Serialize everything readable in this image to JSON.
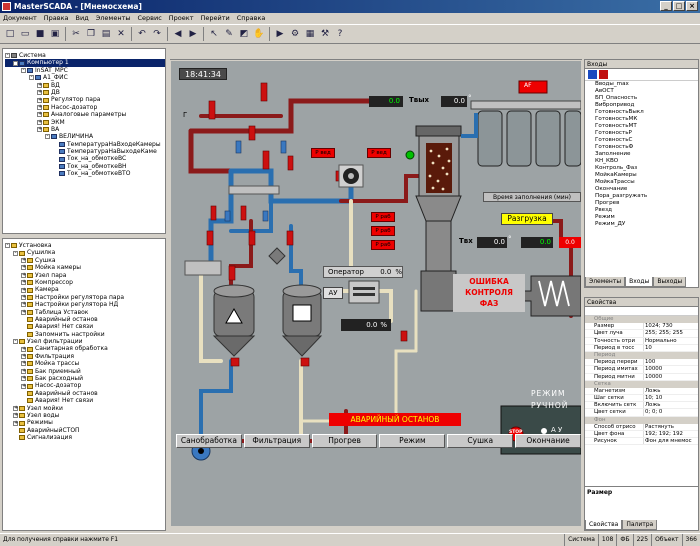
{
  "window": {
    "title": "MasterSCADA - [Мнемосхема]"
  },
  "menu": [
    "Документ",
    "Правка",
    "Вид",
    "Элементы",
    "Сервис",
    "Проект",
    "Перейти",
    "Справка"
  ],
  "toolbar_icons": [
    "new-icon",
    "open-icon",
    "save-icon",
    "save-all-icon",
    "cut-icon",
    "copy-icon",
    "paste-icon",
    "delete-icon",
    "undo-icon",
    "redo-icon",
    "back-icon",
    "forward-icon",
    "pointer-icon",
    "pen-icon",
    "fill-icon",
    "hand-icon",
    "run-icon",
    "debug-icon",
    "grid-icon",
    "tools-icon",
    "help-icon"
  ],
  "tree_system": [
    {
      "label": "Система",
      "level": 0,
      "icon": "m",
      "exp": "-"
    },
    {
      "label": "Компьютер 1",
      "level": 1,
      "icon": "b",
      "exp": "-",
      "selected": true
    },
    {
      "label": "InSAT_MPC",
      "level": 2,
      "icon": "b",
      "exp": "-"
    },
    {
      "label": "A1_ФИС",
      "level": 3,
      "icon": "b",
      "exp": "-"
    },
    {
      "label": "ВД",
      "level": 4,
      "icon": "",
      "exp": "+"
    },
    {
      "label": "ДВ",
      "level": 4,
      "icon": "",
      "exp": "+"
    },
    {
      "label": "Регулятор пара",
      "level": 4,
      "icon": "",
      "exp": "+"
    },
    {
      "label": "Насос-дозатор",
      "level": 4,
      "icon": "",
      "exp": "+"
    },
    {
      "label": "Аналоговые параметры",
      "level": 4,
      "icon": "",
      "exp": "+"
    },
    {
      "label": "ЭКМ",
      "level": 4,
      "icon": "",
      "exp": "+"
    },
    {
      "label": "ВА",
      "level": 4,
      "icon": "",
      "exp": "+"
    },
    {
      "label": "ВЕЛИЧИНА",
      "level": 5,
      "icon": "b",
      "exp": "-"
    },
    {
      "label": "ТемператураНаВходеКамеры",
      "level": 6,
      "icon": "b",
      "exp": ""
    },
    {
      "label": "ТемператураНаВыходеКаме",
      "level": 6,
      "icon": "b",
      "exp": ""
    },
    {
      "label": "Ток_на_обмоткеВС",
      "level": 6,
      "icon": "b",
      "exp": ""
    },
    {
      "label": "Ток_на_обмоткеВН",
      "level": 6,
      "icon": "b",
      "exp": ""
    },
    {
      "label": "Ток_на_обмоткеВТО",
      "level": 6,
      "icon": "b",
      "exp": ""
    }
  ],
  "tree_install": [
    {
      "label": "Установка",
      "level": 0,
      "exp": "-"
    },
    {
      "label": "Сушилка",
      "level": 1,
      "exp": "-"
    },
    {
      "label": "Сушка",
      "level": 2,
      "exp": "+"
    },
    {
      "label": "Мойка камеры",
      "level": 2,
      "exp": "+"
    },
    {
      "label": "Узел пара",
      "level": 2,
      "exp": "+"
    },
    {
      "label": "Компрессор",
      "level": 2,
      "exp": "+"
    },
    {
      "label": "Камера",
      "level": 2,
      "exp": "+"
    },
    {
      "label": "Настройки регулятора пара",
      "level": 2,
      "exp": "+"
    },
    {
      "label": "Настройки регулятора НД",
      "level": 2,
      "exp": "+"
    },
    {
      "label": "Таблица Уставок",
      "level": 2,
      "exp": "+"
    },
    {
      "label": "Аварийный останов",
      "level": 2,
      "exp": ""
    },
    {
      "label": "Авария! Нет связи",
      "level": 2,
      "exp": ""
    },
    {
      "label": "Запомнить настройки",
      "level": 2,
      "exp": ""
    },
    {
      "label": "Узел фильтрации",
      "level": 1,
      "exp": "-"
    },
    {
      "label": "Санитарная обработка",
      "level": 2,
      "exp": "+"
    },
    {
      "label": "Фильтрация",
      "level": 2,
      "exp": "+"
    },
    {
      "label": "Мойка трассы",
      "level": 2,
      "exp": "+"
    },
    {
      "label": "Бак приемный",
      "level": 2,
      "exp": "+"
    },
    {
      "label": "Бак расходный",
      "level": 2,
      "exp": "+"
    },
    {
      "label": "Насос-дозатор",
      "level": 2,
      "exp": "+"
    },
    {
      "label": "Аварийный останов",
      "level": 2,
      "exp": ""
    },
    {
      "label": "Авария! Нет связи",
      "level": 2,
      "exp": ""
    },
    {
      "label": "Узел мойки",
      "level": 1,
      "exp": "+"
    },
    {
      "label": "Узел воды",
      "level": 1,
      "exp": "+"
    },
    {
      "label": "Режимы",
      "level": 1,
      "exp": "+"
    },
    {
      "label": "АварийныйСТОП",
      "level": 1,
      "exp": ""
    },
    {
      "label": "Сигнализация",
      "level": 1,
      "exp": ""
    }
  ],
  "scada": {
    "time": "18:41:34",
    "g_label": "Г",
    "t_out_label": "Твых",
    "t_out_value": "0.0",
    "t_out_unit": "°",
    "t_in_label": "Твх",
    "t_in_value": "0.0",
    "t_in_unit": "°",
    "green_value": "0.0",
    "green_value2": "0.0",
    "red_value": "0.0",
    "fill_time": "Время заполнения (мин)",
    "unload": "Разгрузка",
    "operator": "Оператор",
    "operator_value": "0.0",
    "operator_unit": "%",
    "au": "АУ",
    "pct_value": "0.0",
    "pct_unit": "%",
    "error_lines": [
      "ОШИБКА",
      "КОНТРОЛЯ",
      "ФАЗ"
    ],
    "emergency": "АВАРИЙНЫЙ ОСТАНОВ",
    "mode_label1": "РЕЖИМ",
    "mode_label2": "РУЧНОЙ",
    "stop": "STOP",
    "radio_au": "А У",
    "radio_du": "Д У",
    "heater_label": "AF",
    "small_labels": [
      "Р вед",
      "Р вед",
      "Р раб",
      "Р раб",
      "Р раб"
    ],
    "nav": [
      "Санобработка",
      "Фильтрация",
      "Прогрев",
      "Режим",
      "Сушка",
      "Окончание"
    ]
  },
  "inputs_panel": {
    "title": "Входы",
    "items": [
      "Вводы_max",
      "АвОСТ",
      "БП_Опасность",
      "Вибропривод",
      "ГотовностьВыкл",
      "ГотовностьМК",
      "ГотовностьМТ",
      "ГотовностьР",
      "ГотовностьС",
      "ГотовностьФ",
      "Заполнение",
      "КН_КВО",
      "Контроль_Фаз",
      "МойкаКамеры",
      "МойкаТрассы",
      "Окончание",
      "Пора_разгружать",
      "Прогрев",
      "Рвезд",
      "Режим",
      "Режим_ДУ"
    ],
    "tabs": [
      "Элементы",
      "Входы",
      "Выходы"
    ]
  },
  "props_panel": {
    "title": "Свойства",
    "rows": [
      {
        "group": "Общие"
      },
      {
        "k": "Размер",
        "v": "1024; 730"
      },
      {
        "k": "Цвет луча",
        "v": "255; 255; 255"
      },
      {
        "k": "Точность отри",
        "v": "Нормально"
      },
      {
        "k": "Период в тосс",
        "v": "10"
      },
      {
        "group": "Период"
      },
      {
        "k": "Период перери",
        "v": "100"
      },
      {
        "k": "Период имитах",
        "v": "10000"
      },
      {
        "k": "Период митни",
        "v": "10000"
      },
      {
        "group": "Сетка"
      },
      {
        "k": "Магнетизм",
        "v": "Ложь"
      },
      {
        "k": "Шаг сетки",
        "v": "10; 10"
      },
      {
        "k": "Включить сетк",
        "v": "Ложь"
      },
      {
        "k": "Цвет сетки",
        "v": "0; 0; 0"
      },
      {
        "group": "Фон"
      },
      {
        "k": "Способ отрисо",
        "v": "Растянуть"
      },
      {
        "k": "Цвет фона",
        "v": "192; 192; 192"
      },
      {
        "k": "Рисунок",
        "v": "Фон для мнемос"
      }
    ],
    "footer": "Размер",
    "tabs": [
      "Свойства",
      "Палитра"
    ]
  },
  "status": {
    "hint": "Для получения справки нажмите F1",
    "system": "Система",
    "n1": "108",
    "fb": "ФБ",
    "n2": "225",
    "objects": "Объект",
    "n3": "366"
  },
  "colors": {
    "accent": "#0a246a",
    "scada_bg": "#9da3a5",
    "red": "#e00000",
    "green": "#00c000"
  }
}
